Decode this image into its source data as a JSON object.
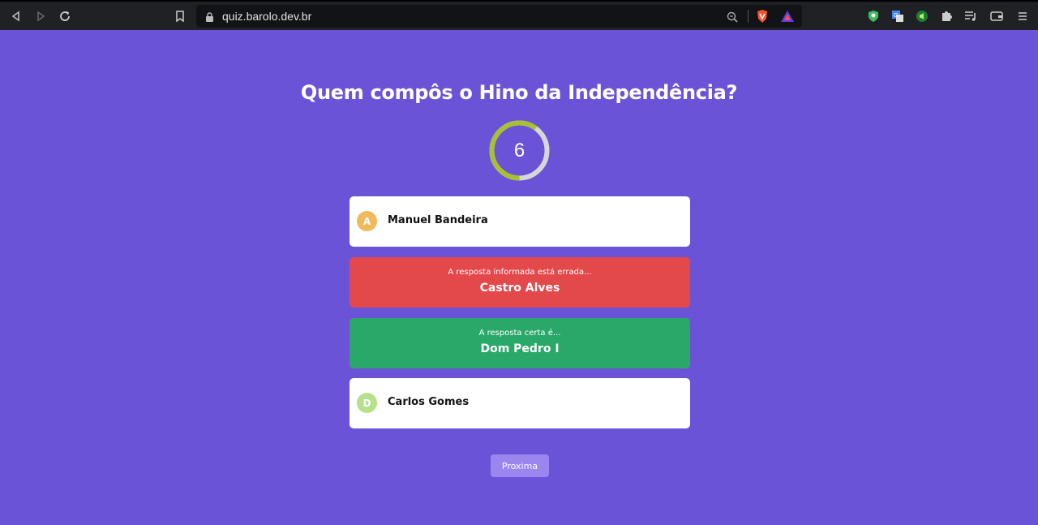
{
  "browser": {
    "url": "quiz.barolo.dev.br"
  },
  "quiz": {
    "question": "Quem compôs o Hino da Independência?",
    "timer_value": "6",
    "timer_progress": 0.6,
    "options": [
      {
        "letter": "A",
        "text": "Manuel Bandeira",
        "state": "default",
        "badge_color": "#f0b95b"
      },
      {
        "status_text": "A resposta informada está errada...",
        "text": "Castro Alves",
        "state": "wrong",
        "color": "#e3484b"
      },
      {
        "status_text": "A resposta certa é...",
        "text": "Dom Pedro I",
        "state": "correct",
        "color": "#2aa86a"
      },
      {
        "letter": "D",
        "text": "Carlos Gomes",
        "state": "default",
        "badge_color": "#b7e08a"
      }
    ],
    "next_label": "Proxima"
  },
  "colors": {
    "background": "#6b53d8",
    "timer_ring": "#a8c132",
    "timer_track": "#d7d7d7"
  }
}
